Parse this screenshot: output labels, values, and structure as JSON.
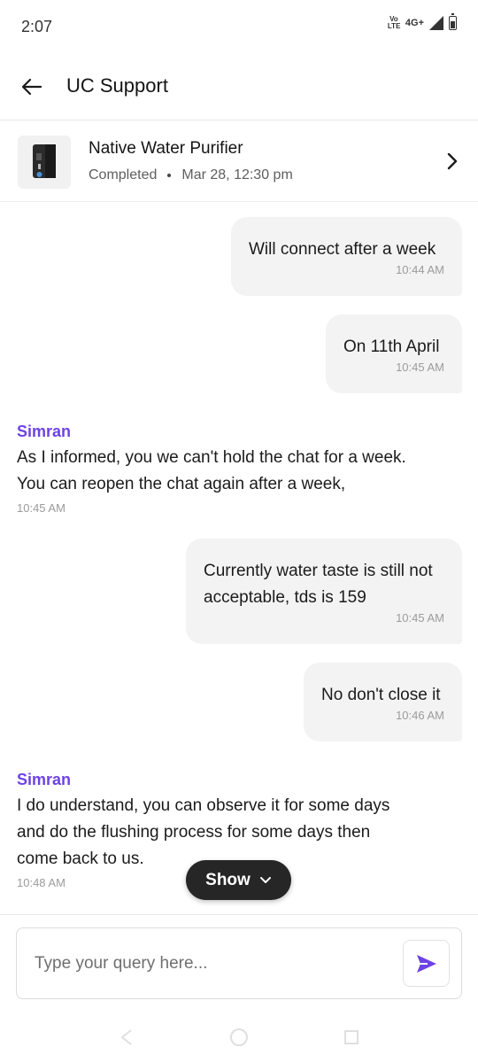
{
  "status_bar": {
    "time": "2:07",
    "volte": "Vo LTE",
    "network": "4G+"
  },
  "header": {
    "title": "UC Support"
  },
  "booking": {
    "title": "Native Water Purifier",
    "status": "Completed",
    "datetime": "Mar 28, 12:30 pm"
  },
  "messages": [
    {
      "from": "user",
      "text": "Will connect after a week",
      "time": "10:44 AM"
    },
    {
      "from": "user",
      "text": "On 11th April",
      "time": "10:45 AM"
    },
    {
      "from": "agent",
      "name": "Simran",
      "text": "As I informed, you we can't hold the chat for a week. You can reopen the chat again after a week,",
      "time": "10:45 AM"
    },
    {
      "from": "user",
      "text": "Currently water taste is still not acceptable, tds is 159",
      "time": "10:45 AM"
    },
    {
      "from": "user",
      "text": "No don't close it",
      "time": "10:46 AM"
    },
    {
      "from": "agent",
      "name": "Simran",
      "text": "I do understand, you can observe it for some days and do the flushing process for some days then come back to us.",
      "time": "10:48 AM"
    }
  ],
  "show_pill": {
    "label": "Show"
  },
  "composer": {
    "placeholder": "Type your query here..."
  },
  "colors": {
    "accent": "#6e42e5",
    "bubble": "#f3f3f3",
    "pill": "#262626"
  },
  "icons": [
    "back-arrow-icon",
    "chevron-right-icon",
    "chevron-down-icon",
    "send-icon",
    "purifier-icon"
  ]
}
